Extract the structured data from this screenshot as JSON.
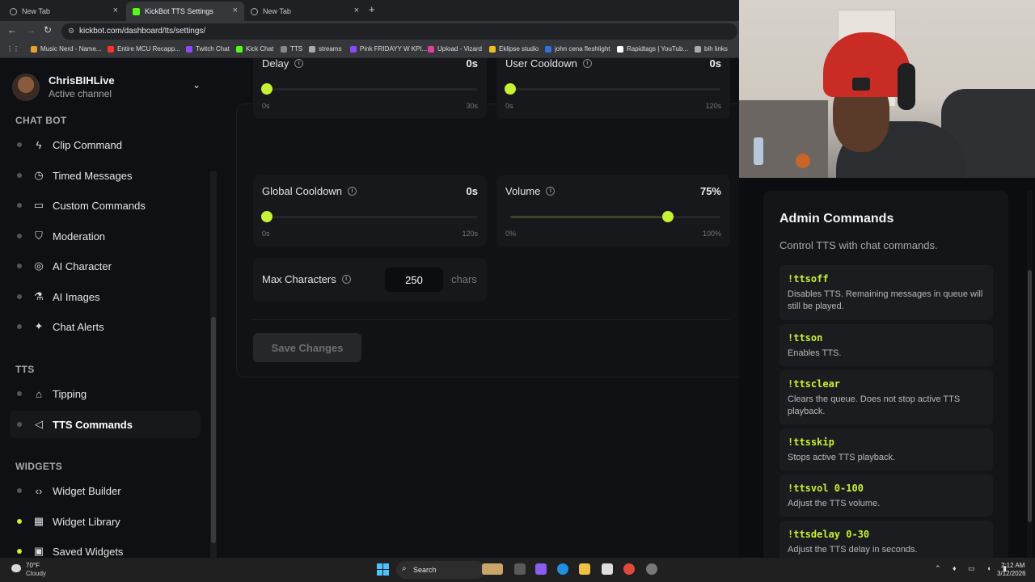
{
  "browser": {
    "tabs": [
      {
        "label": "New Tab",
        "active": false
      },
      {
        "label": "KickBot TTS Settings",
        "active": true
      },
      {
        "label": "New Tab",
        "active": false
      }
    ],
    "url": "kickbot.com/dashboard/tts/settings/",
    "bookmarks": [
      {
        "label": "Music Nerd - Name...",
        "color": "#e8a030"
      },
      {
        "label": "Entire MCU Recapp...",
        "color": "#ff3030"
      },
      {
        "label": "Twitch Chat",
        "color": "#9146ff"
      },
      {
        "label": "Kick Chat",
        "color": "#53fc18"
      },
      {
        "label": "TTS",
        "color": "#888888"
      },
      {
        "label": "streams",
        "color": "#aaaaaa"
      },
      {
        "label": "Pink FRIDAYY W KPI...",
        "color": "#9146ff"
      },
      {
        "label": "Upload - Vizard",
        "color": "#e040a0"
      },
      {
        "label": "Eklipse studio",
        "color": "#f0c020"
      },
      {
        "label": "john cena fleshlight",
        "color": "#3070e0"
      },
      {
        "label": "Rapidtags | YouTub...",
        "color": "#ffffff"
      },
      {
        "label": "bih links",
        "color": "#aaaaaa"
      }
    ]
  },
  "channel": {
    "name": "ChrisBIHLive",
    "subtitle": "Active channel"
  },
  "sidebar": {
    "sections": [
      {
        "title": "CHAT BOT",
        "items": [
          {
            "label": "Clip Command",
            "icon": "bolt-icon",
            "glyph": "ϟ",
            "dot": false,
            "active": false
          },
          {
            "label": "Timed Messages",
            "icon": "timer-icon",
            "glyph": "◷",
            "dot": false,
            "active": false
          },
          {
            "label": "Custom Commands",
            "icon": "command-icon",
            "glyph": "▭",
            "dot": false,
            "active": false
          },
          {
            "label": "Moderation",
            "icon": "shield-icon",
            "glyph": "⛉",
            "dot": false,
            "active": false
          },
          {
            "label": "AI Character",
            "icon": "character-icon",
            "glyph": "◎",
            "dot": false,
            "active": false
          },
          {
            "label": "AI Images",
            "icon": "flask-icon",
            "glyph": "⚗",
            "dot": false,
            "active": false
          },
          {
            "label": "Chat Alerts",
            "icon": "gift-icon",
            "glyph": "✦",
            "dot": false,
            "active": false
          }
        ]
      },
      {
        "title": "TTS",
        "items": [
          {
            "label": "Tipping",
            "icon": "store-icon",
            "glyph": "⌂",
            "dot": false,
            "active": false
          },
          {
            "label": "TTS Commands",
            "icon": "speaker-icon",
            "glyph": "◁",
            "dot": false,
            "active": true
          }
        ]
      },
      {
        "title": "WIDGETS",
        "items": [
          {
            "label": "Widget Builder",
            "icon": "code-icon",
            "glyph": "‹›",
            "dot": false,
            "active": false
          },
          {
            "label": "Widget Library",
            "icon": "grid-icon",
            "glyph": "▦",
            "dot": true,
            "active": false
          },
          {
            "label": "Saved Widgets",
            "icon": "bookmark-icon",
            "glyph": "▣",
            "dot": true,
            "active": false
          }
        ]
      }
    ]
  },
  "settings": {
    "delay": {
      "label": "Delay",
      "value": "0s",
      "min": "0s",
      "max": "30s",
      "fraction": 0
    },
    "user_cooldown": {
      "label": "User Cooldown",
      "value": "0s",
      "min": "0s",
      "max": "120s",
      "fraction": 0
    },
    "global_cooldown": {
      "label": "Global Cooldown",
      "value": "0s",
      "min": "0s",
      "max": "120s",
      "fraction": 0
    },
    "volume": {
      "label": "Volume",
      "value": "75%",
      "min": "0%",
      "max": "100%",
      "fraction": 0.75
    },
    "max_characters": {
      "label": "Max Characters",
      "value": "250",
      "unit": "chars"
    },
    "save_label": "Save Changes"
  },
  "admin": {
    "title": "Admin Commands",
    "subtitle": "Control TTS with chat commands.",
    "commands": [
      {
        "name": "!ttsoff",
        "desc": "Disables TTS. Remaining messages in queue will still be played."
      },
      {
        "name": "!ttson",
        "desc": "Enables TTS."
      },
      {
        "name": "!ttsclear",
        "desc": "Clears the queue. Does not stop active TTS playback."
      },
      {
        "name": "!ttsskip",
        "desc": "Stops active TTS playback."
      },
      {
        "name": "!ttsvol 0-100",
        "desc": "Adjust the TTS volume."
      },
      {
        "name": "!ttsdelay 0-30",
        "desc": "Adjust the TTS delay in seconds."
      }
    ]
  },
  "taskbar": {
    "weather_temp": "70°F",
    "weather_desc": "Cloudy",
    "search_label": "Search",
    "time": "2:12 AM",
    "date": "3/12/2026"
  },
  "accent_color": "#c6f135"
}
